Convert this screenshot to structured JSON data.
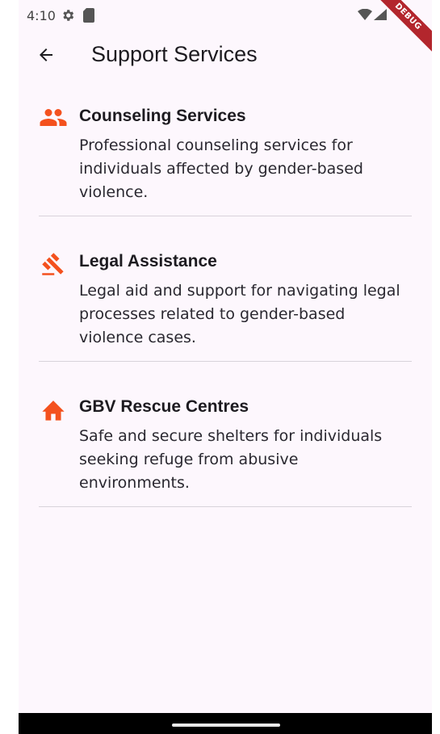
{
  "status_bar": {
    "time": "4:10",
    "debug_label": "DEBUG"
  },
  "app_bar": {
    "title": "Support Services"
  },
  "services": [
    {
      "icon": "people-icon",
      "title": "Counseling Services",
      "description": "Professional counseling services for individuals affected by gender-based violence."
    },
    {
      "icon": "gavel-icon",
      "title": "Legal Assistance",
      "description": "Legal aid and support for navigating legal processes related to gender-based violence cases."
    },
    {
      "icon": "home-icon",
      "title": "GBV Rescue Centres",
      "description": "Safe and secure shelters for individuals seeking refuge from abusive environments."
    }
  ],
  "colors": {
    "accent": "#f4511e",
    "background": "#fdf7fd",
    "divider": "#d8d3da"
  }
}
